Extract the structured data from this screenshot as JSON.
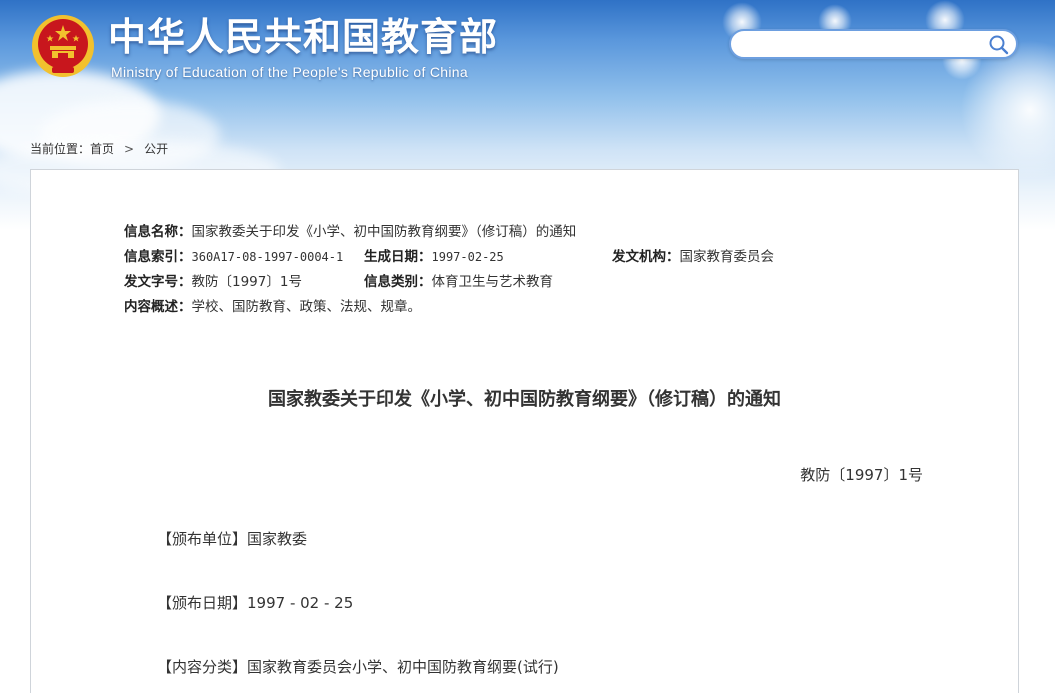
{
  "header": {
    "title": "中华人民共和国教育部",
    "subtitle": "Ministry of Education of the People's Republic of China",
    "search": {
      "value": "",
      "placeholder": ""
    }
  },
  "breadcrumb": {
    "prefix": "当前位置：",
    "items": [
      "首页",
      "公开"
    ],
    "separator": ">"
  },
  "meta": {
    "name": {
      "label": "信息名称：",
      "value": "国家教委关于印发《小学、初中国防教育纲要》（修订稿）的通知"
    },
    "index": {
      "label": "信息索引：",
      "value": "360A17-08-1997-0004-1"
    },
    "date": {
      "label": "生成日期：",
      "value": "1997-02-25"
    },
    "issuer": {
      "label": "发文机构：",
      "value": "国家教育委员会"
    },
    "doc_no": {
      "label": "发文字号：",
      "value": "教防〔1997〕1号"
    },
    "category": {
      "label": "信息类别：",
      "value": "体育卫生与艺术教育"
    },
    "summary": {
      "label": "内容概述：",
      "value": "学校、国防教育、政策、法规、规章。"
    }
  },
  "document": {
    "title": "国家教委关于印发《小学、初中国防教育纲要》（修订稿）的通知",
    "number": "教防〔1997〕1号",
    "paragraphs": [
      "【颁布单位】国家教委",
      "【颁布日期】1997 - 02 - 25",
      "【内容分类】国家教育委员会小学、初中国防教育纲要(试行)"
    ]
  },
  "colors": {
    "sky_top": "#2f72c6",
    "search_border": "#6d9fe0",
    "emblem_red": "#c8161d",
    "emblem_gold": "#f2c12e",
    "text": "#333333"
  }
}
